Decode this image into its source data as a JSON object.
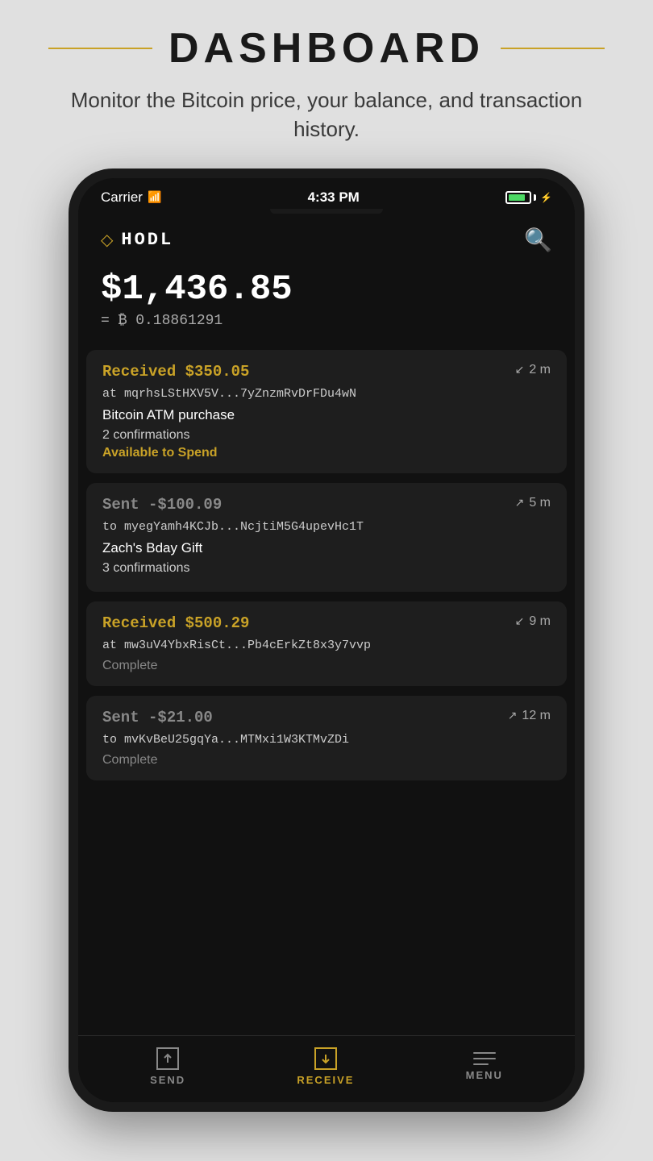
{
  "header": {
    "title": "DASHBOARD",
    "subtitle": "Monitor the Bitcoin price, your balance, and transaction history."
  },
  "status_bar": {
    "carrier": "Carrier",
    "time": "4:33 PM"
  },
  "app": {
    "logo_text": "HODL",
    "balance_usd": "$1,436.85",
    "balance_btc": "= ₿ 0.18861291"
  },
  "transactions": [
    {
      "type": "received",
      "amount": "Received $350.05",
      "address": "at mqrhsLStHXV5V...7yZnzmRvDrFDu4wN",
      "time": "2 m",
      "label": "Bitcoin ATM purchase",
      "confirmations": "2 confirmations",
      "status": "Available to Spend",
      "status_type": "available"
    },
    {
      "type": "sent",
      "amount": "Sent -$100.09",
      "address": "to myegYamh4KCJb...NcjtiM5G4upevHc1T",
      "time": "5 m",
      "label": "Zach's Bday Gift",
      "confirmations": "3 confirmations",
      "status": "",
      "status_type": "none"
    },
    {
      "type": "received",
      "amount": "Received $500.29",
      "address": "at mw3uV4YbxRisCt...Pb4cErkZt8x3y7vvp",
      "time": "9 m",
      "label": "",
      "confirmations": "",
      "status": "Complete",
      "status_type": "complete"
    },
    {
      "type": "sent",
      "amount": "Sent -$21.00",
      "address": "to mvKvBeU25gqYa...MTMxi1W3KTMvZDi",
      "time": "12 m",
      "label": "",
      "confirmations": "",
      "status": "Complete",
      "status_type": "complete"
    }
  ],
  "nav": {
    "send_label": "SEND",
    "receive_label": "RECEIVE",
    "menu_label": "MENU"
  }
}
